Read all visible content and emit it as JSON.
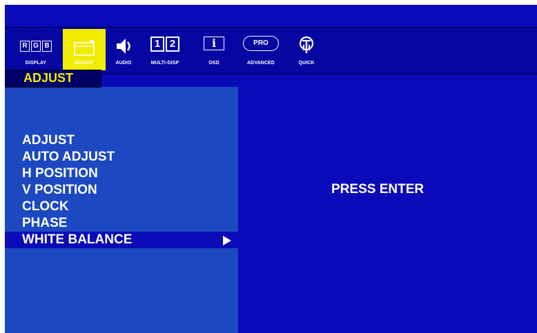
{
  "tabs": [
    {
      "id": "display",
      "label": "DISPLAY",
      "icon": "rgb-icon",
      "glyphs": [
        "R",
        "G",
        "B"
      ]
    },
    {
      "id": "adjust",
      "label": "ADJUST",
      "icon": "adjust-icon",
      "active": true
    },
    {
      "id": "audio",
      "label": "AUDIO",
      "icon": "speaker-icon"
    },
    {
      "id": "multi-disp",
      "label": "MULTI-DISP",
      "icon": "multi-display-icon",
      "glyphs": [
        "1",
        "2"
      ]
    },
    {
      "id": "osd",
      "label": "OSD",
      "icon": "info-icon",
      "glyph": "i"
    },
    {
      "id": "advanced",
      "label": "ADVANCED",
      "icon": "pro-icon",
      "glyph": "PRO"
    },
    {
      "id": "quick",
      "label": "QUICK",
      "icon": "quick-icon"
    }
  ],
  "section_title": "ADJUST",
  "menu": {
    "items": [
      {
        "label": "ADJUST"
      },
      {
        "label": "AUTO ADJUST"
      },
      {
        "label": "H POSITION"
      },
      {
        "label": "V POSITION"
      },
      {
        "label": "CLOCK"
      },
      {
        "label": "PHASE"
      },
      {
        "label": "WHITE BALANCE",
        "selected": true
      }
    ]
  },
  "detail": {
    "message": "PRESS ENTER"
  },
  "colors": {
    "background": "#0a0ab8",
    "panel": "#1c49c1",
    "highlight": "#f2ec00",
    "text": "#ffffff"
  }
}
